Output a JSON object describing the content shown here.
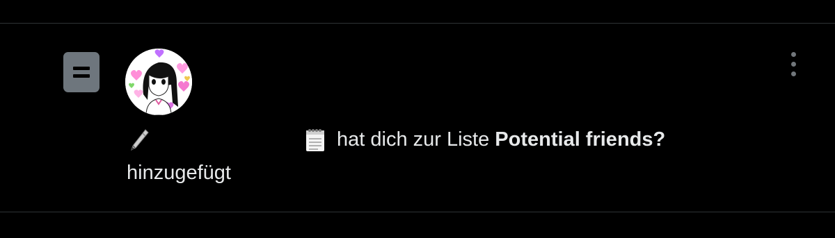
{
  "notification": {
    "type_icon": "list-icon",
    "avatar_icon": "user-avatar",
    "more_icon": "vertical-ellipsis-icon",
    "display_name_emoji_1": "pencil-icon",
    "display_name_emoji_2": "notepad-icon",
    "action_text": "hat dich zur Liste",
    "list_name": "Potential friends?",
    "action_suffix": "hinzugefügt"
  },
  "colors": {
    "background": "#000000",
    "divider": "#2f3336",
    "text": "#e7e9ea",
    "icon_gray": "#6e767d",
    "more_dots": "#71767b"
  }
}
